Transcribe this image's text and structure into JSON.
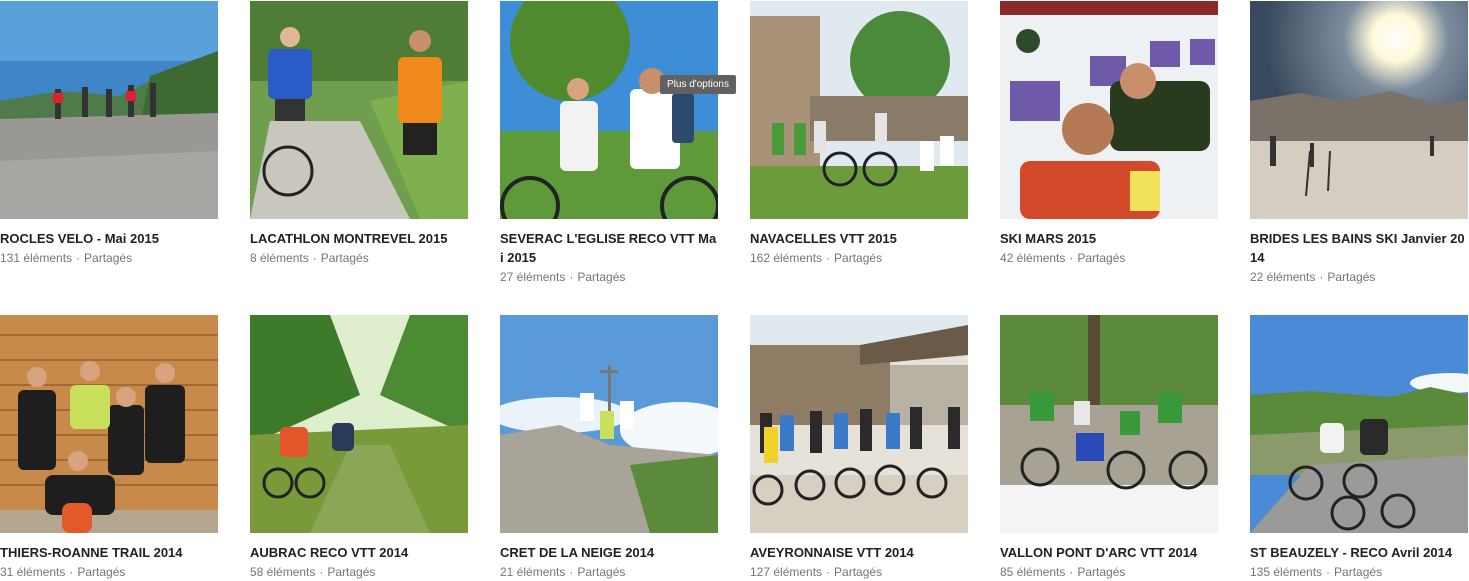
{
  "tooltip": "Plus d'options",
  "separator": "·",
  "albums": [
    {
      "title": "ROCLES VELO - Mai 2015",
      "count": "131 éléments",
      "status": "Partagés"
    },
    {
      "title": "LACATHLON MONTREVEL 2015",
      "count": "8 éléments",
      "status": "Partagés"
    },
    {
      "title": "SEVERAC L'EGLISE RECO VTT Mai 2015",
      "count": "27 éléments",
      "status": "Partagés"
    },
    {
      "title": "NAVACELLES VTT 2015",
      "count": "162 éléments",
      "status": "Partagés"
    },
    {
      "title": "SKI MARS 2015",
      "count": "42 éléments",
      "status": "Partagés"
    },
    {
      "title": "BRIDES LES BAINS SKI Janvier 2014",
      "count": "22 éléments",
      "status": "Partagés"
    },
    {
      "title": "THIERS-ROANNE TRAIL 2014",
      "count": "31 éléments",
      "status": "Partagés"
    },
    {
      "title": "AUBRAC RECO VTT 2014",
      "count": "58 éléments",
      "status": "Partagés"
    },
    {
      "title": "CRET DE LA NEIGE 2014",
      "count": "21 éléments",
      "status": "Partagés"
    },
    {
      "title": "AVEYRONNAISE VTT 2014",
      "count": "127 éléments",
      "status": "Partagés"
    },
    {
      "title": "VALLON PONT D'ARC VTT 2014",
      "count": "85 éléments",
      "status": "Partagés"
    },
    {
      "title": "ST BEAUZELY - RECO Avril 2014",
      "count": "135 éléments",
      "status": "Partagés"
    }
  ]
}
